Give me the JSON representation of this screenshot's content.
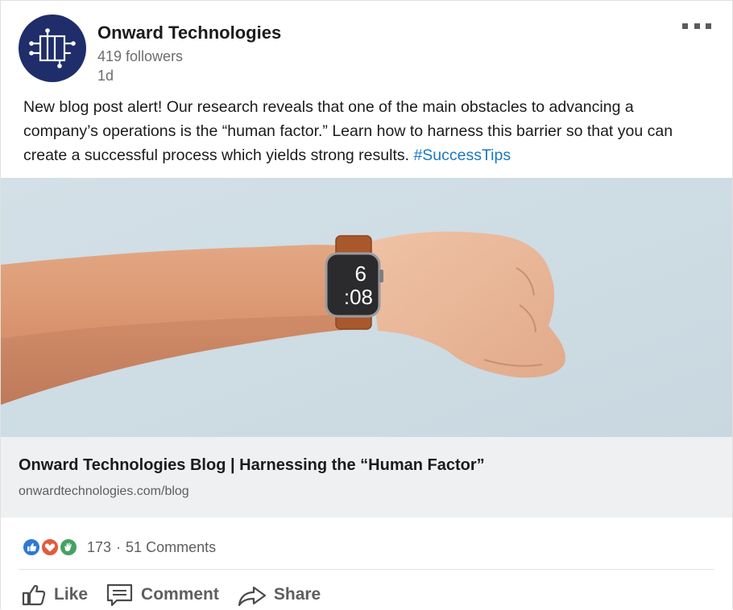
{
  "post": {
    "company_name": "Onward Technologies",
    "followers": "419 followers",
    "timestamp": "1d",
    "text": "New blog post alert! Our research reveals that one of the main obstacles to advancing a company’s operations is the “human factor.” Learn how to harness this barrier so that you can create a successful process which yields strong results. ",
    "hashtag": "#SuccessTips"
  },
  "image": {
    "watch_hour": "6",
    "watch_minutes": ":08"
  },
  "link_preview": {
    "title": "Onward Technologies Blog | Harnessing the “Human Factor”",
    "url": "onwardtechnologies.com/blog"
  },
  "social": {
    "reaction_count": "173",
    "separator": "·",
    "comments": "51 Comments",
    "reactions": [
      "like-reaction-icon",
      "love-reaction-icon",
      "celebrate-reaction-icon"
    ]
  },
  "actions": {
    "like": "Like",
    "comment": "Comment",
    "share": "Share"
  },
  "colors": {
    "avatar_bg": "#1f2d6a",
    "hashtag": "#1a78c2",
    "like_reaction": "#2e7ad0",
    "love_reaction": "#e25b3d",
    "celebrate_reaction": "#45a163",
    "image_background": "#cfdde4",
    "link_preview_bg": "#eef0f2"
  }
}
